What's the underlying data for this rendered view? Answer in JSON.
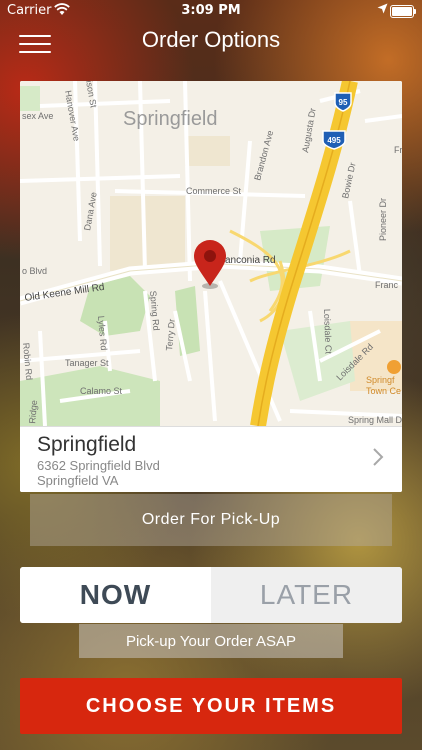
{
  "status_bar": {
    "carrier": "Carrier",
    "time": "3:09 PM"
  },
  "header": {
    "title": "Order Options"
  },
  "map": {
    "city_label": "Springfield",
    "labels": {
      "hanover_ave": "Hanover Ave",
      "essex_ave": "sex Ave",
      "ison_st": "ison St",
      "commerce_st": "Commerce St",
      "dana_ave": "Dana Ave",
      "brandon_ave": "Brandon Ave",
      "augusta_dr": "Augusta Dr",
      "bowie_dr": "Bowie Dr",
      "pioneer_dr": "Pioneer Dr",
      "fr": "Fr",
      "old_keene_mill_rd": "Old Keene Mill Rd",
      "o_blvd": "o Blvd",
      "franconia_rd": "anconia Rd",
      "franc": "Franc",
      "spring_rd": "Spring Rd",
      "lyles_rd": "Lyles Rd",
      "terry_dr": "Terry Dr",
      "tanager_st": "Tanager St",
      "calamo_st": "Calamo St",
      "robin_rd": "Robin Rd",
      "ridge": "Ridge",
      "loisdale_ct": "Loisdale Ct",
      "loisdale_rd": "Loisdale Rd",
      "springfield_town_center": "Springf",
      "town_center": "Town Ce",
      "spring_mall_dr": "Spring Mall D"
    },
    "shields": {
      "i95": "95",
      "i495": "495"
    }
  },
  "location": {
    "name": "Springfield",
    "address_line1": "6362 Springfield Blvd",
    "address_line2": "Springfield VA"
  },
  "order_type_label": "Order For Pick-Up",
  "timing": {
    "now_label": "NOW",
    "later_label": "LATER",
    "selected": "NOW"
  },
  "timing_hint": "Pick-up Your Order ASAP",
  "choose_items_label": "CHOOSE YOUR ITEMS",
  "colors": {
    "accent": "#d7270e",
    "highway": "#f5c731",
    "pin": "#c8251b"
  }
}
